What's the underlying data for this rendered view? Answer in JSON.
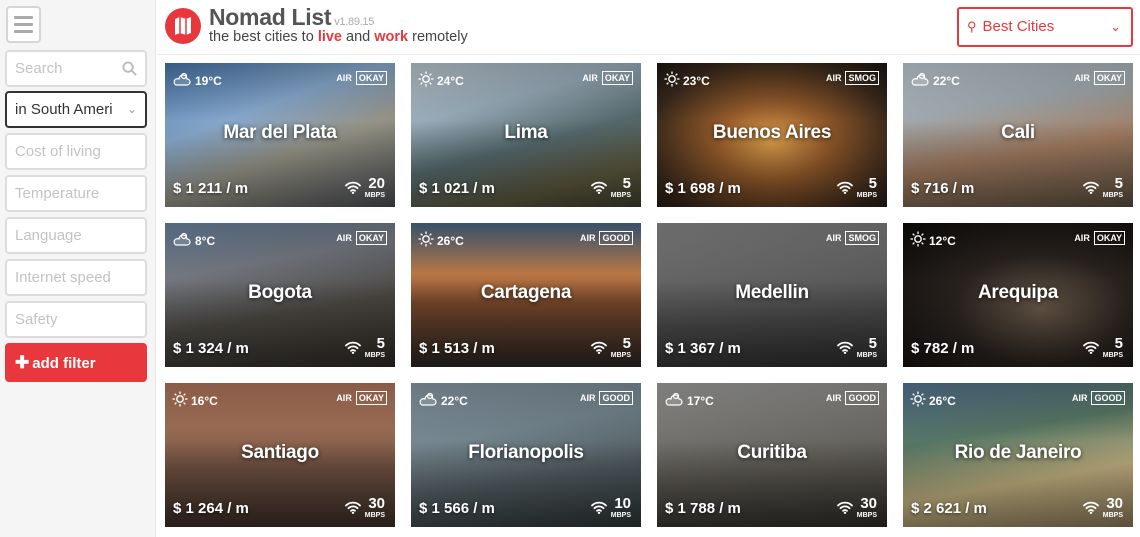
{
  "header": {
    "brand": "Nomad List",
    "version": "v1.89.15",
    "tagline": {
      "part1": "the best cities to ",
      "live": "live",
      "part2": " and ",
      "work": "work",
      "part3": " remotely"
    },
    "sort_label": "Best Cities",
    "accent": "#e8383d"
  },
  "sidebar": {
    "search_placeholder": "Search",
    "region_filter": "in South Ameri",
    "filters": [
      "Cost of living",
      "Temperature",
      "Language",
      "Internet speed",
      "Safety"
    ],
    "add_filter": "add filter"
  },
  "cities": [
    {
      "name": "Mar del Plata",
      "temp": "19°C",
      "weather": "cloudy",
      "air_label": "AIR",
      "air": "OKAY",
      "cost": "$ 1 211 / m",
      "speed": "20",
      "unit": "MBPS",
      "bg": "linear-gradient(160deg,#4a7ab0 0%,#8db0d6 35%,#9c9a8c 60%,#4a4d52 100%)"
    },
    {
      "name": "Lima",
      "temp": "24°C",
      "weather": "sunny",
      "air_label": "AIR",
      "air": "OKAY",
      "cost": "$ 1 021 / m",
      "speed": "5",
      "unit": "MBPS",
      "bg": "linear-gradient(165deg,#c3d0d9 0%,#9fb3c1 30%,#596e72 55%,#5d5a3e 80%,#3f4030 100%)"
    },
    {
      "name": "Buenos Aires",
      "temp": "23°C",
      "weather": "sunny",
      "air_label": "AIR",
      "air": "SMOG",
      "cost": "$ 1 698 / m",
      "speed": "5",
      "unit": "MBPS",
      "bg": "radial-gradient(ellipse at 50% 55%,#e6a54e 0%,#9a5e2c 35%,#3b2a1c 75%,#1c1510 100%)"
    },
    {
      "name": "Cali",
      "temp": "22°C",
      "weather": "cloudy",
      "air_label": "AIR",
      "air": "OKAY",
      "cost": "$ 716 / m",
      "speed": "5",
      "unit": "MBPS",
      "bg": "linear-gradient(170deg,#c9d4de 0%,#a9b4ba 30%,#a67f63 60%,#5c5040 100%)"
    },
    {
      "name": "Bogota",
      "temp": "8°C",
      "weather": "cloudy",
      "air_label": "AIR",
      "air": "OKAY",
      "cost": "$ 1 324 / m",
      "speed": "5",
      "unit": "MBPS",
      "bg": "linear-gradient(170deg,#6e8aa8 0%,#7b7f88 30%,#4d4a44 60%,#2e2a25 100%)"
    },
    {
      "name": "Cartagena",
      "temp": "26°C",
      "weather": "sunny",
      "air_label": "AIR",
      "air": "GOOD",
      "cost": "$ 1 513 / m",
      "speed": "5",
      "unit": "MBPS",
      "bg": "linear-gradient(180deg,#4a6d8c 0%,#c9804a 35%,#7a4a2c 55%,#2a2624 100%)"
    },
    {
      "name": "Medellin",
      "temp": "",
      "weather": "",
      "air_label": "AIR",
      "air": "SMOG",
      "cost": "$ 1 367 / m",
      "speed": "5",
      "unit": "MBPS",
      "bg": "linear-gradient(175deg,#8f8f8f 0%,#6a6a6a 35%,#4a4a4a 65%,#2c2c2c 100%)"
    },
    {
      "name": "Arequipa",
      "temp": "12°C",
      "weather": "sunny",
      "air_label": "AIR",
      "air": "OKAY",
      "cost": "$ 782 / m",
      "speed": "5",
      "unit": "MBPS",
      "bg": "radial-gradient(ellipse at 60% 60%,#6b5a4a 0%,#2a2420 45%,#0d0b0a 100%)"
    },
    {
      "name": "Santiago",
      "temp": "16°C",
      "weather": "sunny",
      "air_label": "AIR",
      "air": "OKAY",
      "cost": "$ 1 264 / m",
      "speed": "30",
      "unit": "MBPS",
      "bg": "linear-gradient(180deg,#b87a5e 0%,#a8765c 30%,#6e5040 60%,#3c2e28 100%)"
    },
    {
      "name": "Florianopolis",
      "temp": "22°C",
      "weather": "cloudy",
      "air_label": "AIR",
      "air": "GOOD",
      "cost": "$ 1 566 / m",
      "speed": "10",
      "unit": "MBPS",
      "bg": "linear-gradient(170deg,#8ea0ae 0%,#7a8c96 35%,#4f5a5e 65%,#2c3434 100%)"
    },
    {
      "name": "Curitiba",
      "temp": "17°C",
      "weather": "cloudy",
      "air_label": "AIR",
      "air": "GOOD",
      "cost": "$ 1 788 / m",
      "speed": "30",
      "unit": "MBPS",
      "bg": "linear-gradient(175deg,#a7a7a5 0%,#7a7874 35%,#55524c 65%,#2e2c28 100%)"
    },
    {
      "name": "Rio de Janeiro",
      "temp": "26°C",
      "weather": "sunny",
      "air_label": "AIR",
      "air": "GOOD",
      "cost": "$ 2 621 / m",
      "speed": "30",
      "unit": "MBPS",
      "bg": "linear-gradient(170deg,#5a7a9a 0%,#5b7d6a 35%,#c2b180 65%,#8c7a5a 100%)"
    }
  ]
}
